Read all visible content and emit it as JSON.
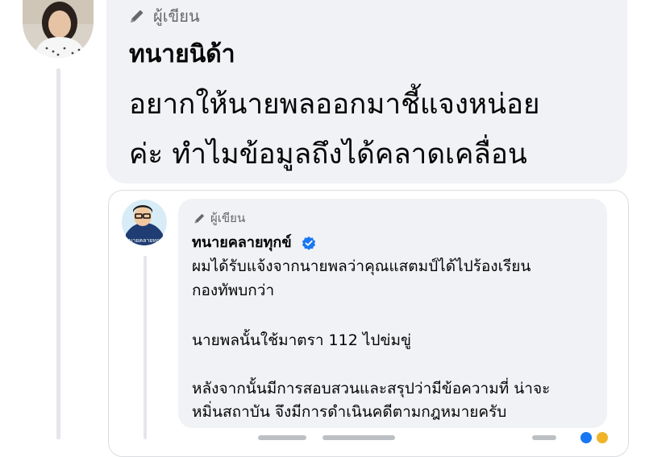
{
  "main_comment": {
    "author_tag": "ผู้เขียน",
    "name": "ทนายนิด้า",
    "lines": [
      "อยากให้นายพลออกมาชี้แจงหน่อย",
      "ค่ะ ทำไมข้อมูลถึงได้คลาดเคลื่อน"
    ]
  },
  "shared_comment": {
    "author_tag": "ผู้เขียน",
    "name": "ทนายคลายทุกข์",
    "avatar_caption": "ทนายคลายทุกข์",
    "lines": [
      "ผมได้รับแจ้งจากนายพลว่าคุณแสตมป์ได้ไปร้องเรียน",
      "กองทัพบกว่า",
      "นายพลนั้นใช้มาตรา 112 ไปข่มขู่",
      "หลังจากนั้นมีการสอบสวนและสรุปว่ามีข้อความที่ น่าจะ",
      "หมิ่นสถาบัน จึงมีการดำเนินคดีตามกฎหมายครับ"
    ]
  },
  "colors": {
    "bubble": "#f0f2f5",
    "verified": "#1877f2",
    "meta_text": "#65676b"
  },
  "icons": [
    "pencil-icon",
    "verified-badge-icon"
  ]
}
